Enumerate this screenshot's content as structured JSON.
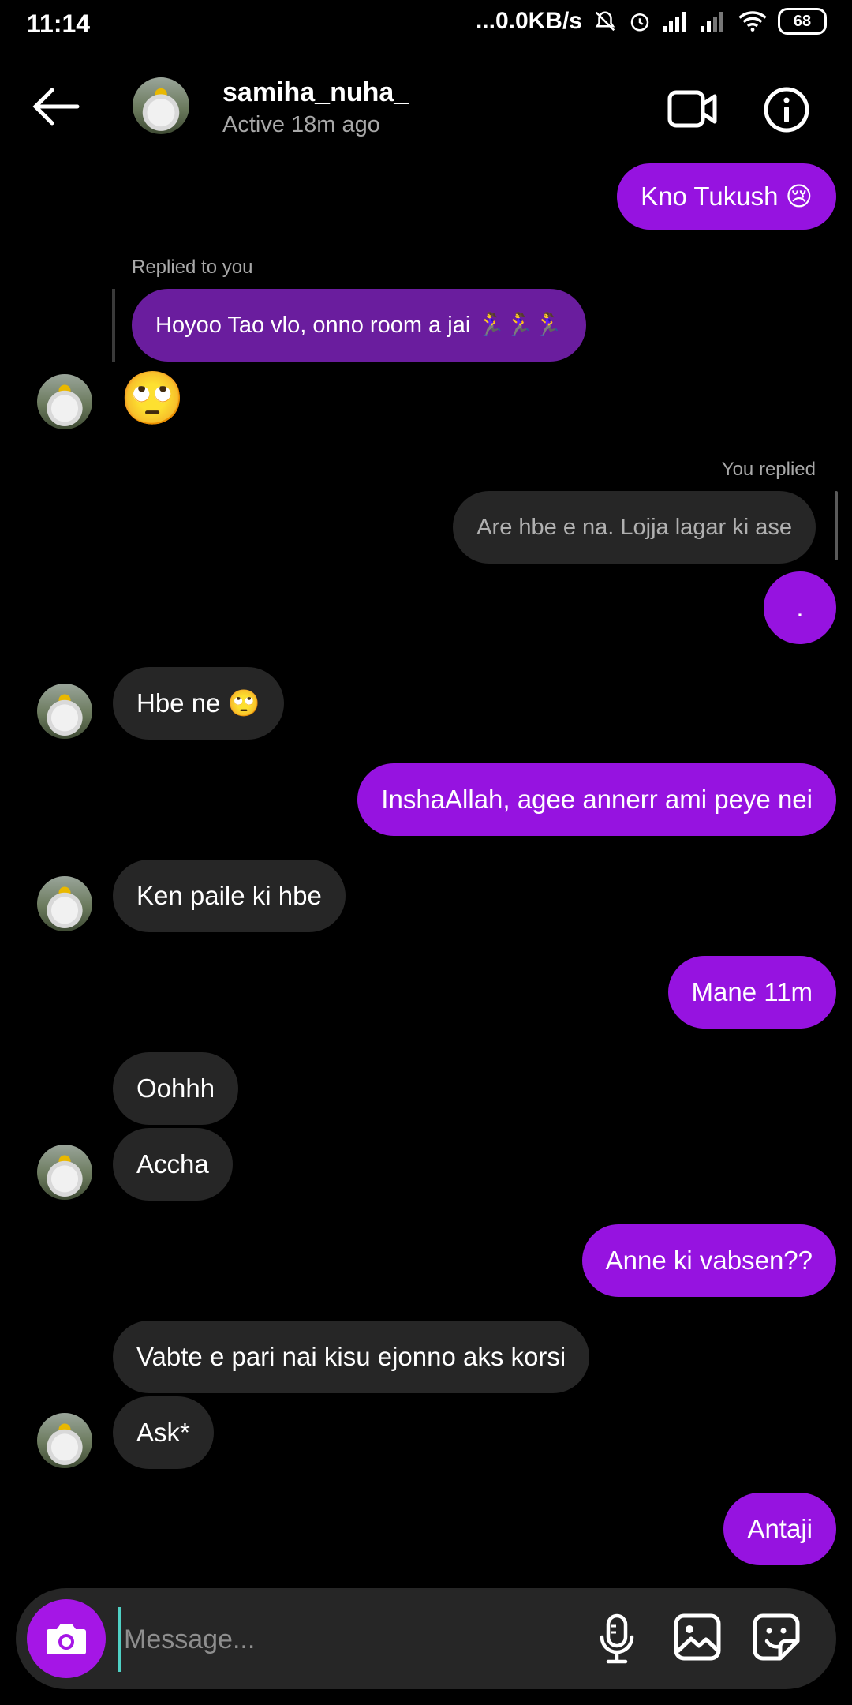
{
  "status_bar": {
    "time": "11:14",
    "net_speed": "...0.0KB/s",
    "battery": "68"
  },
  "header": {
    "username": "samiha_nuha_",
    "active_status": "Active 18m ago"
  },
  "messages": {
    "m1": {
      "text": "Kno Tukush 😢"
    },
    "m2_label": "Replied to you",
    "m2_quote": "Hoyoo Tao vlo, onno room a jai 🏃‍♀️🏃‍♀️🏃‍♀️",
    "m3": "🙄",
    "m4_label": "You replied",
    "m4_quote": "Are hbe e na. Lojja lagar ki ase",
    "m5": ".",
    "m6": "Hbe ne 🙄",
    "m7": "InshaAllah, agee annerr ami peye nei",
    "m8": "Ken paile ki hbe",
    "m9": "Mane 11m",
    "m10": "Oohhh",
    "m11": "Accha",
    "m12": "Anne ki vabsen??",
    "m13": "Vabte e pari nai kisu ejonno aks korsi",
    "m14": "Ask*",
    "m15": "Antaji"
  },
  "composer": {
    "placeholder": "Message..."
  },
  "colors": {
    "outgoing_bubble": "#9613e0",
    "incoming_bubble": "#262626",
    "camera_button": "#a516e6"
  },
  "icons": [
    "back-arrow-icon",
    "video-call-icon",
    "info-icon",
    "camera-icon",
    "microphone-icon",
    "gallery-icon",
    "sticker-icon"
  ]
}
